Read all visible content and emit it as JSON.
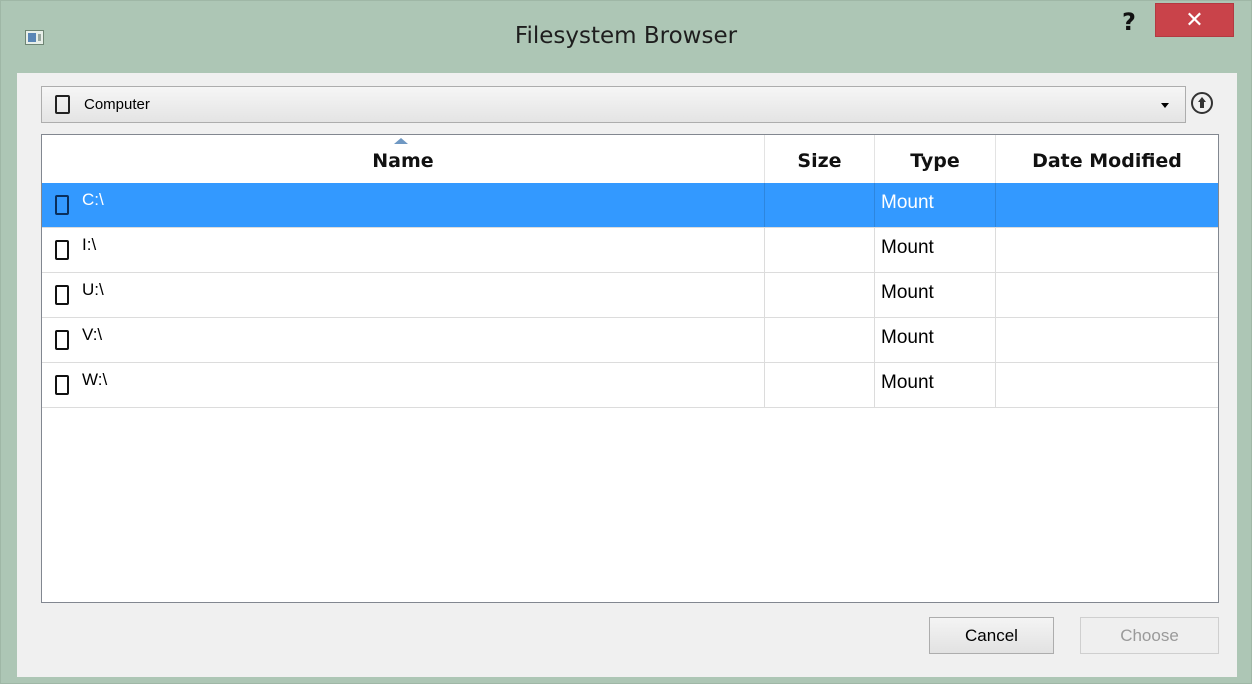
{
  "window": {
    "title": "Filesystem Browser",
    "help_label": "?",
    "close_label": "✕"
  },
  "location": {
    "current": "Computer"
  },
  "table": {
    "columns": [
      "Name",
      "Size",
      "Type",
      "Date Modified"
    ],
    "sort_column": "Name",
    "rows": [
      {
        "name": "C:\\",
        "size": "",
        "type": "Mount",
        "date_modified": "",
        "selected": true
      },
      {
        "name": "I:\\",
        "size": "",
        "type": "Mount",
        "date_modified": "",
        "selected": false
      },
      {
        "name": "U:\\",
        "size": "",
        "type": "Mount",
        "date_modified": "",
        "selected": false
      },
      {
        "name": "V:\\",
        "size": "",
        "type": "Mount",
        "date_modified": "",
        "selected": false
      },
      {
        "name": "W:\\",
        "size": "",
        "type": "Mount",
        "date_modified": "",
        "selected": false
      }
    ]
  },
  "buttons": {
    "cancel_label": "Cancel",
    "choose_label": "Choose",
    "choose_enabled": false
  },
  "colors": {
    "selection": "#3399ff",
    "titlebar": "#adc6b5",
    "close_button": "#c9434a"
  },
  "icons": {
    "app": "app-window-icon",
    "drive": "drive-icon",
    "up": "up-arrow-circle-icon",
    "dropdown": "chevron-down-icon"
  }
}
